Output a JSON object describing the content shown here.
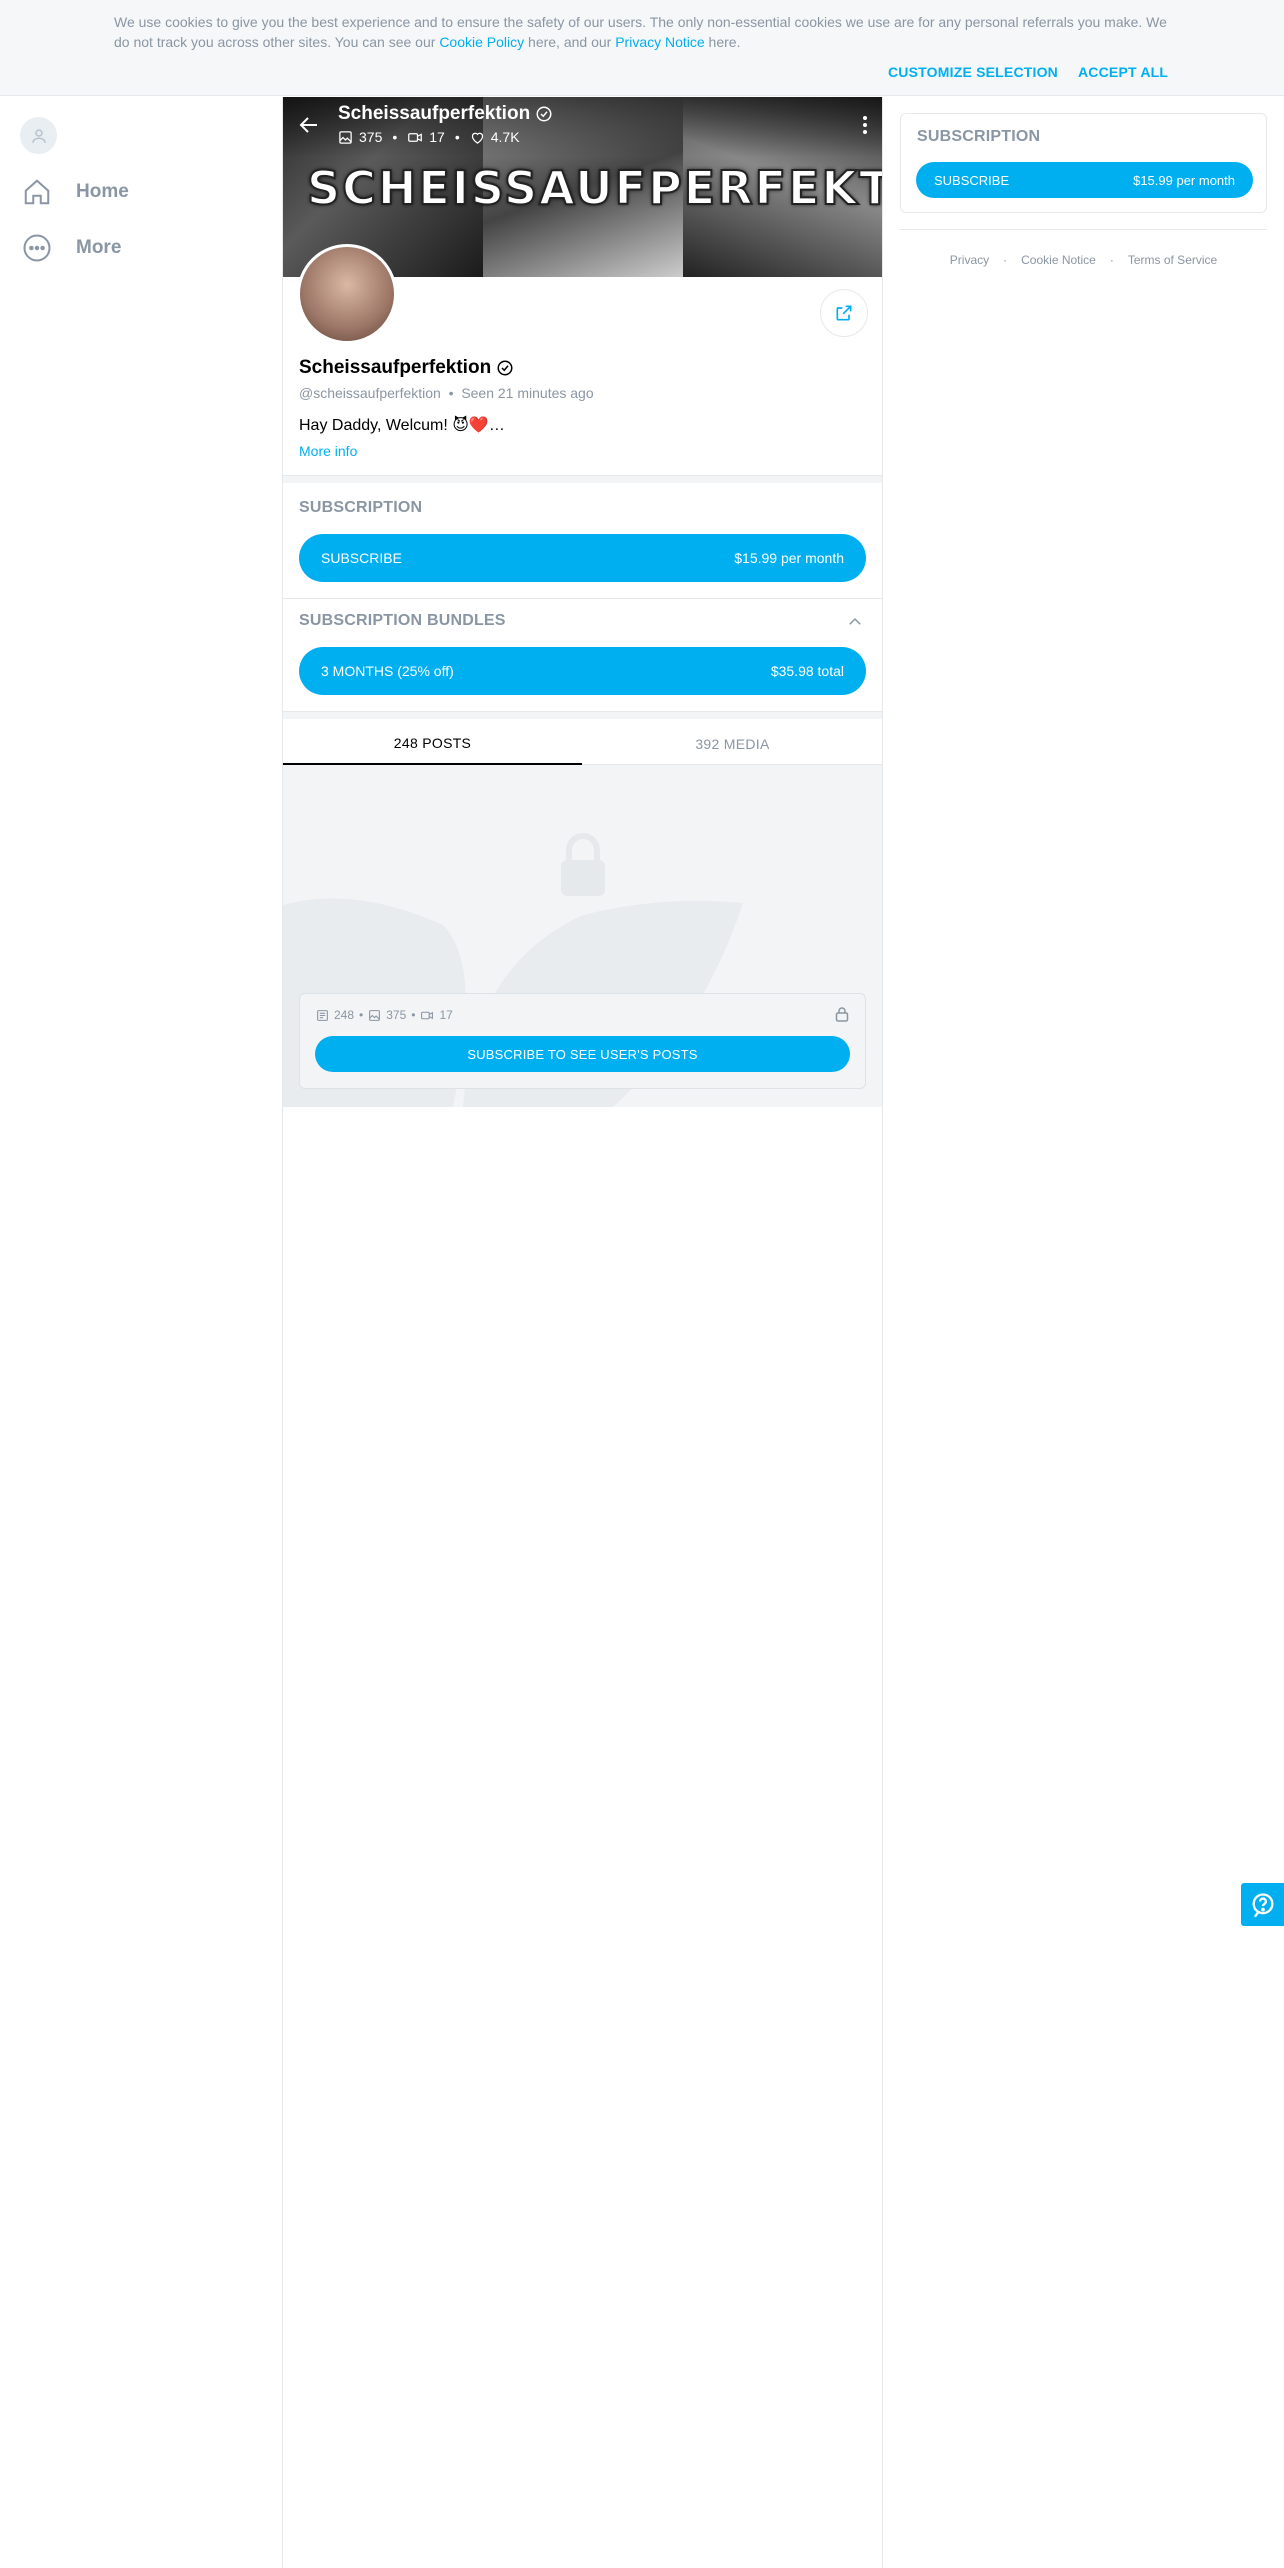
{
  "cookie": {
    "text_before": "We use cookies to give you the best experience and to ensure the safety of our users. The only non-essential cookies we use are for any personal referrals you make. We do not track you across other sites. You can see our ",
    "cookie_link": "Cookie Policy",
    "text_middle": " here, and our ",
    "privacy_link": "Privacy Notice",
    "text_after": " here.",
    "customize_label": "CUSTOMIZE SELECTION",
    "accept_label": "ACCEPT ALL"
  },
  "nav": {
    "items": [
      {
        "label": "Home",
        "icon": "home-icon"
      },
      {
        "label": "More",
        "icon": "more-icon"
      }
    ]
  },
  "cover": {
    "name": "Scheissaufperfektion",
    "brand_text": "SCHEISSAUFPERFEKTION",
    "stats": {
      "photos": "375",
      "videos": "17",
      "likes": "4.7K"
    }
  },
  "profile": {
    "name": "Scheissaufperfektion",
    "handle": "@scheissaufperfektion",
    "seen": "Seen 21 minutes ago",
    "bio": "Hay Daddy, Welcum! 😈❤️…",
    "more_info": "More info"
  },
  "subscription": {
    "title": "SUBSCRIPTION",
    "button_label": "SUBSCRIBE",
    "price": "$15.99 per month"
  },
  "bundles": {
    "title": "SUBSCRIPTION BUNDLES",
    "button_label": "3 MONTHS (25% off)",
    "price": "$35.98 total"
  },
  "tabs": {
    "posts": "248 POSTS",
    "media": "392 MEDIA"
  },
  "locked": {
    "posts": "248",
    "photos": "375",
    "videos": "17",
    "button_label": "SUBSCRIBE TO SEE USER'S POSTS"
  },
  "sidebar": {
    "title": "SUBSCRIPTION",
    "button_label": "SUBSCRIBE",
    "price": "$15.99 per month",
    "footer": [
      "Privacy",
      "Cookie Notice",
      "Terms of Service"
    ]
  },
  "colors": {
    "accent": "#00aff0",
    "muted": "#8a96a3",
    "border": "#e6e9ec"
  }
}
